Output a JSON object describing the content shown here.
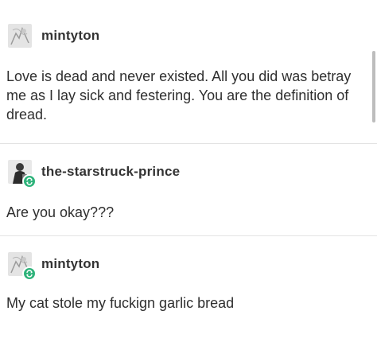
{
  "posts": [
    {
      "username": "mintyton",
      "avatar_icon": "sketch-avatar-icon",
      "reblog": false,
      "text": "Love is dead and never existed. All you did was betray me as I lay sick and festering. You are the definition of dread."
    },
    {
      "username": "the-starstruck-prince",
      "avatar_icon": "figure-avatar-icon",
      "reblog": true,
      "reblog_icon": "reblog-icon",
      "text": "Are you okay???"
    },
    {
      "username": "mintyton",
      "avatar_icon": "sketch-avatar-icon",
      "reblog": true,
      "reblog_icon": "reblog-icon",
      "text": "My cat stole my fuckign garlic bread"
    }
  ],
  "colors": {
    "background": "#ffffff",
    "text": "#2f2f2f",
    "divider": "#e3e3e3",
    "reblog_badge": "#2fb37b"
  }
}
